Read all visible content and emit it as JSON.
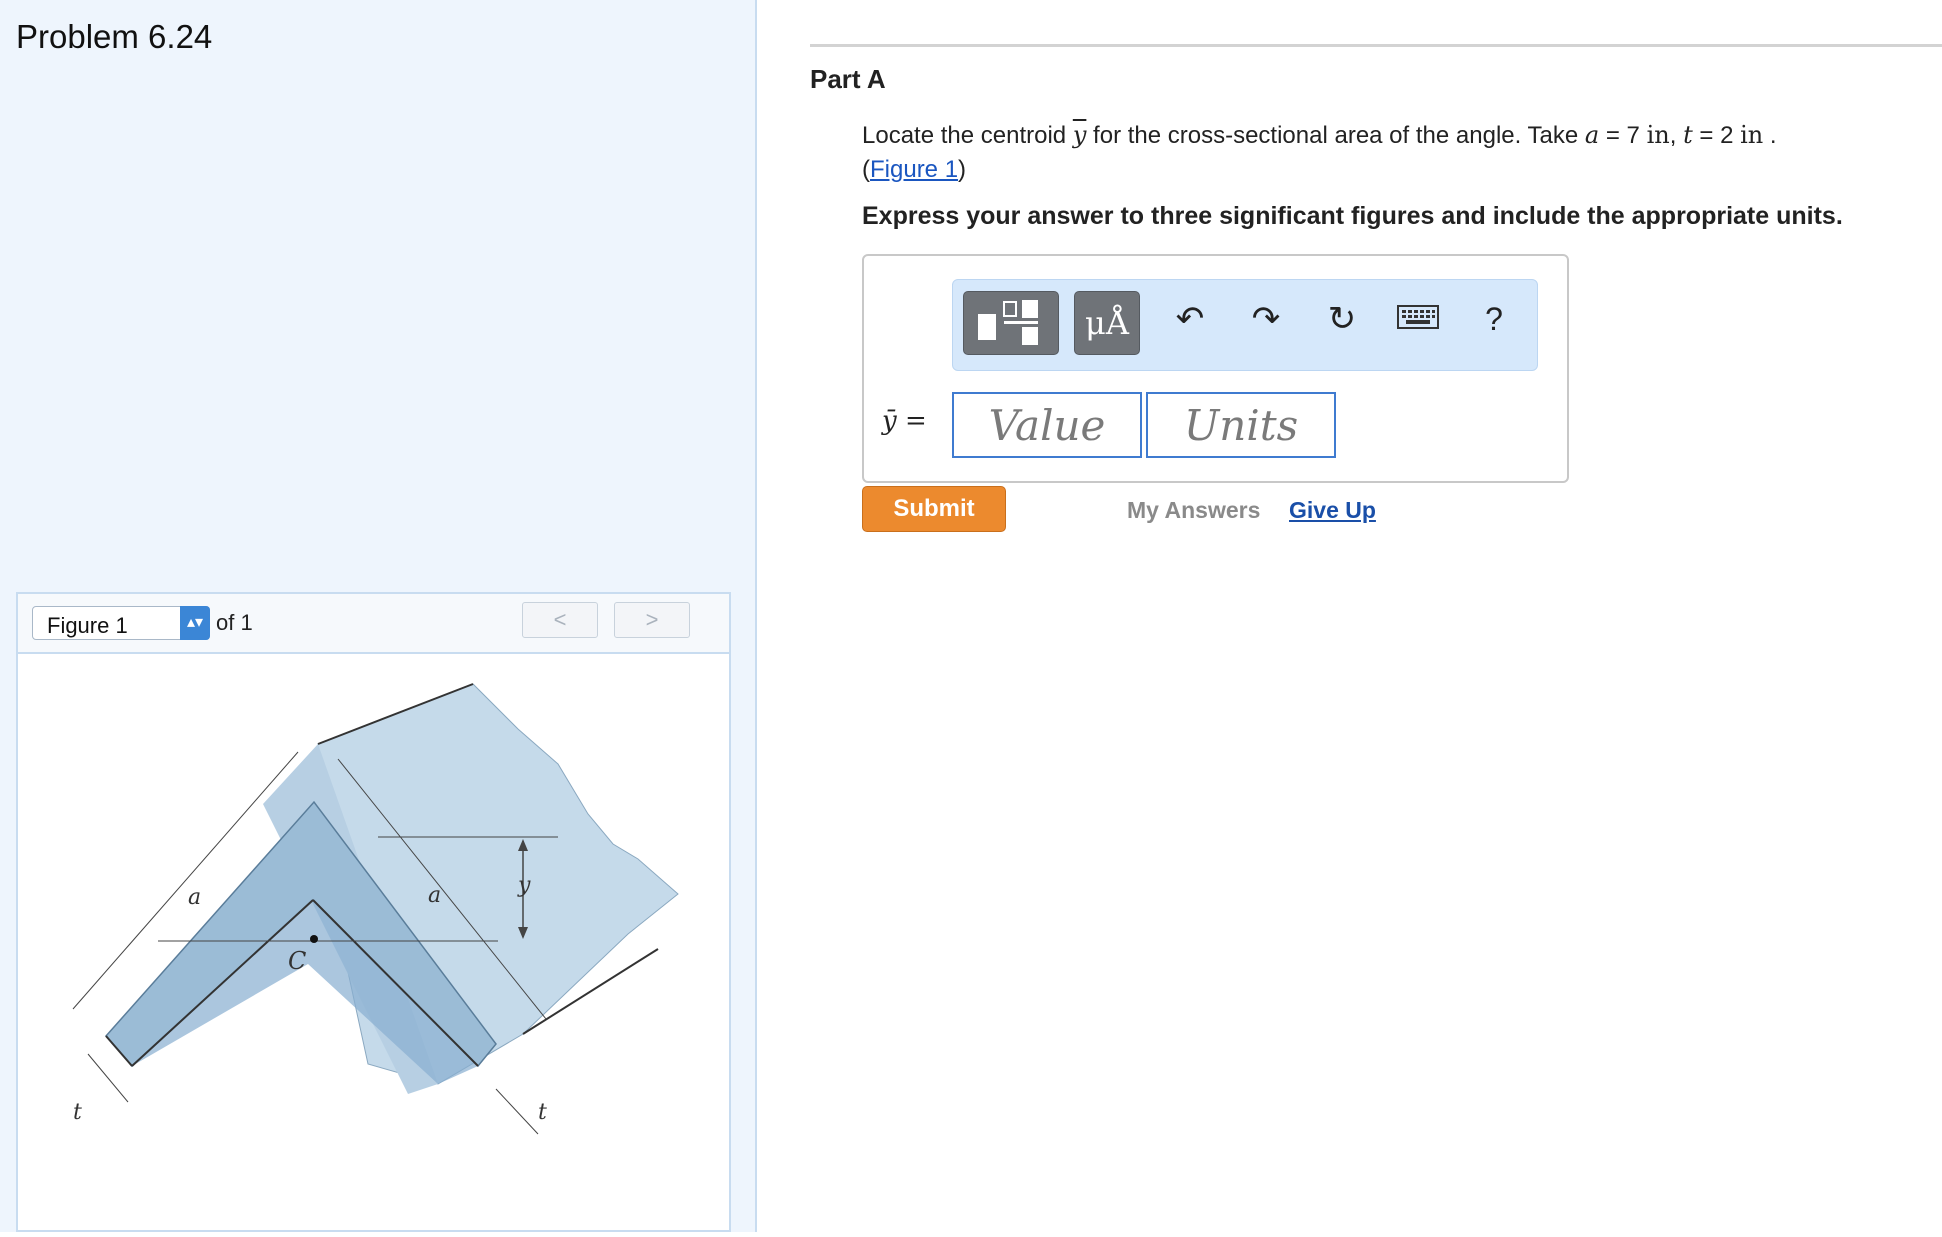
{
  "problem": {
    "title": "Problem 6.24"
  },
  "figure_nav": {
    "selected": "Figure 1",
    "of_text": "of 1",
    "prev_label": "<",
    "next_label": ">"
  },
  "figure": {
    "labels": {
      "a_left": "a",
      "a_right": "a",
      "ybar": "y",
      "centroid": "C",
      "t_left": "t",
      "t_right": "t"
    }
  },
  "part": {
    "title": "Part A",
    "question_text": "Locate the centroid",
    "question_symbol": "y",
    "question_mid": "for the cross-sectional area of the angle. Take",
    "var_a": "a",
    "val_a": "= 7",
    "unit_a": "in",
    "sep": ",",
    "var_t": "t",
    "val_t": "= 2",
    "unit_t": "in",
    "end": ".",
    "figure_link": "Figure 1",
    "instruction": "Express your answer to three significant figures and include the appropriate units."
  },
  "answer": {
    "label": "ȳ =",
    "value_placeholder": "Value",
    "units_placeholder": "Units",
    "toolbar": {
      "units_btn": "μÅ",
      "help": "?"
    }
  },
  "actions": {
    "submit": "Submit",
    "my_answers": "My Answers",
    "give_up": "Give Up"
  },
  "colors": {
    "accent_blue": "#3f7bd0",
    "submit_orange": "#ec8a2e",
    "link_blue": "#1a56c0",
    "left_bg": "#eef5fd"
  }
}
